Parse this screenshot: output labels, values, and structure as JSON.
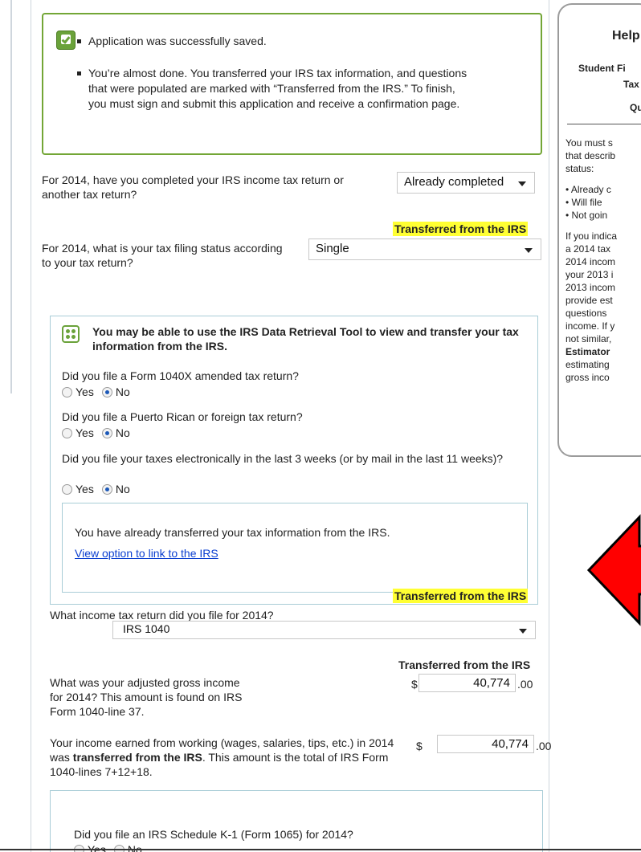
{
  "success": {
    "message1": "Application was successfully saved.",
    "message2": "You’re almost done. You transferred your IRS tax information, and questions that were populated are marked with “Transferred from the IRS.” To finish, you must sign and submit this application and receive a confirmation page."
  },
  "q_completed": {
    "label": "For 2014, have you completed your IRS income tax return or another tax return?",
    "value": "Already completed"
  },
  "transferred_label": "Transferred from the IRS",
  "q_filing_status": {
    "label": "For 2014, what is your tax filing status according to your tax return?",
    "value": "Single"
  },
  "drt": {
    "title": "You may be able to use the IRS Data Retrieval Tool to view and transfer your tax information from the IRS.",
    "q1": "Did you file a Form 1040X amended tax return?",
    "q2": "Did you file a Puerto Rican or foreign tax return?",
    "q3": "Did you file your taxes electronically in the last 3 weeks (or by mail in the last 11 weeks)?",
    "yes": "Yes",
    "no": "No",
    "already": "You have already transferred your tax information from the IRS.",
    "link": "View option to link to the IRS"
  },
  "q_return_type": {
    "label": "What income tax return did you file for 2014?",
    "value": "IRS 1040"
  },
  "q_agi": {
    "label": "What was your adjusted gross income for 2014? This amount is found on IRS Form 1040-line 37.",
    "dollar": "$",
    "value": "40,774",
    "cents": ".00"
  },
  "q_earned": {
    "label_pre": "Your income earned from working (wages, salaries, tips, etc.) in 2014 was ",
    "label_bold": "transferred from the IRS",
    "label_post": ". This amount is the total of IRS Form 1040-lines 7+12+18.",
    "dollar": "$",
    "value": "40,774",
    "cents": ".00"
  },
  "q_k1": {
    "label": "Did you file an IRS Schedule K-1 (Form 1065) for 2014?"
  },
  "help": {
    "title": "Help",
    "sub1": "Student Fi",
    "sub2": "Tax",
    "sub3": "Qu",
    "p1": [
      "You must s",
      "that describ",
      "status:"
    ],
    "bullets": [
      "• Already c",
      "• Will file",
      "• Not goin"
    ],
    "p2": [
      "If you indica",
      "a 2014 tax",
      "2014 incom",
      "your 2013 i",
      "2013 incom",
      "provide est",
      "questions",
      "income. If y",
      "not similar,"
    ],
    "p2_bold": "Estimator",
    "p2_end": [
      "estimating",
      "gross inco"
    ]
  },
  "colors": {
    "success_border": "#73a636",
    "highlight": "#ffff33",
    "link": "#0b3fd0",
    "arrow": "#ff0000"
  }
}
